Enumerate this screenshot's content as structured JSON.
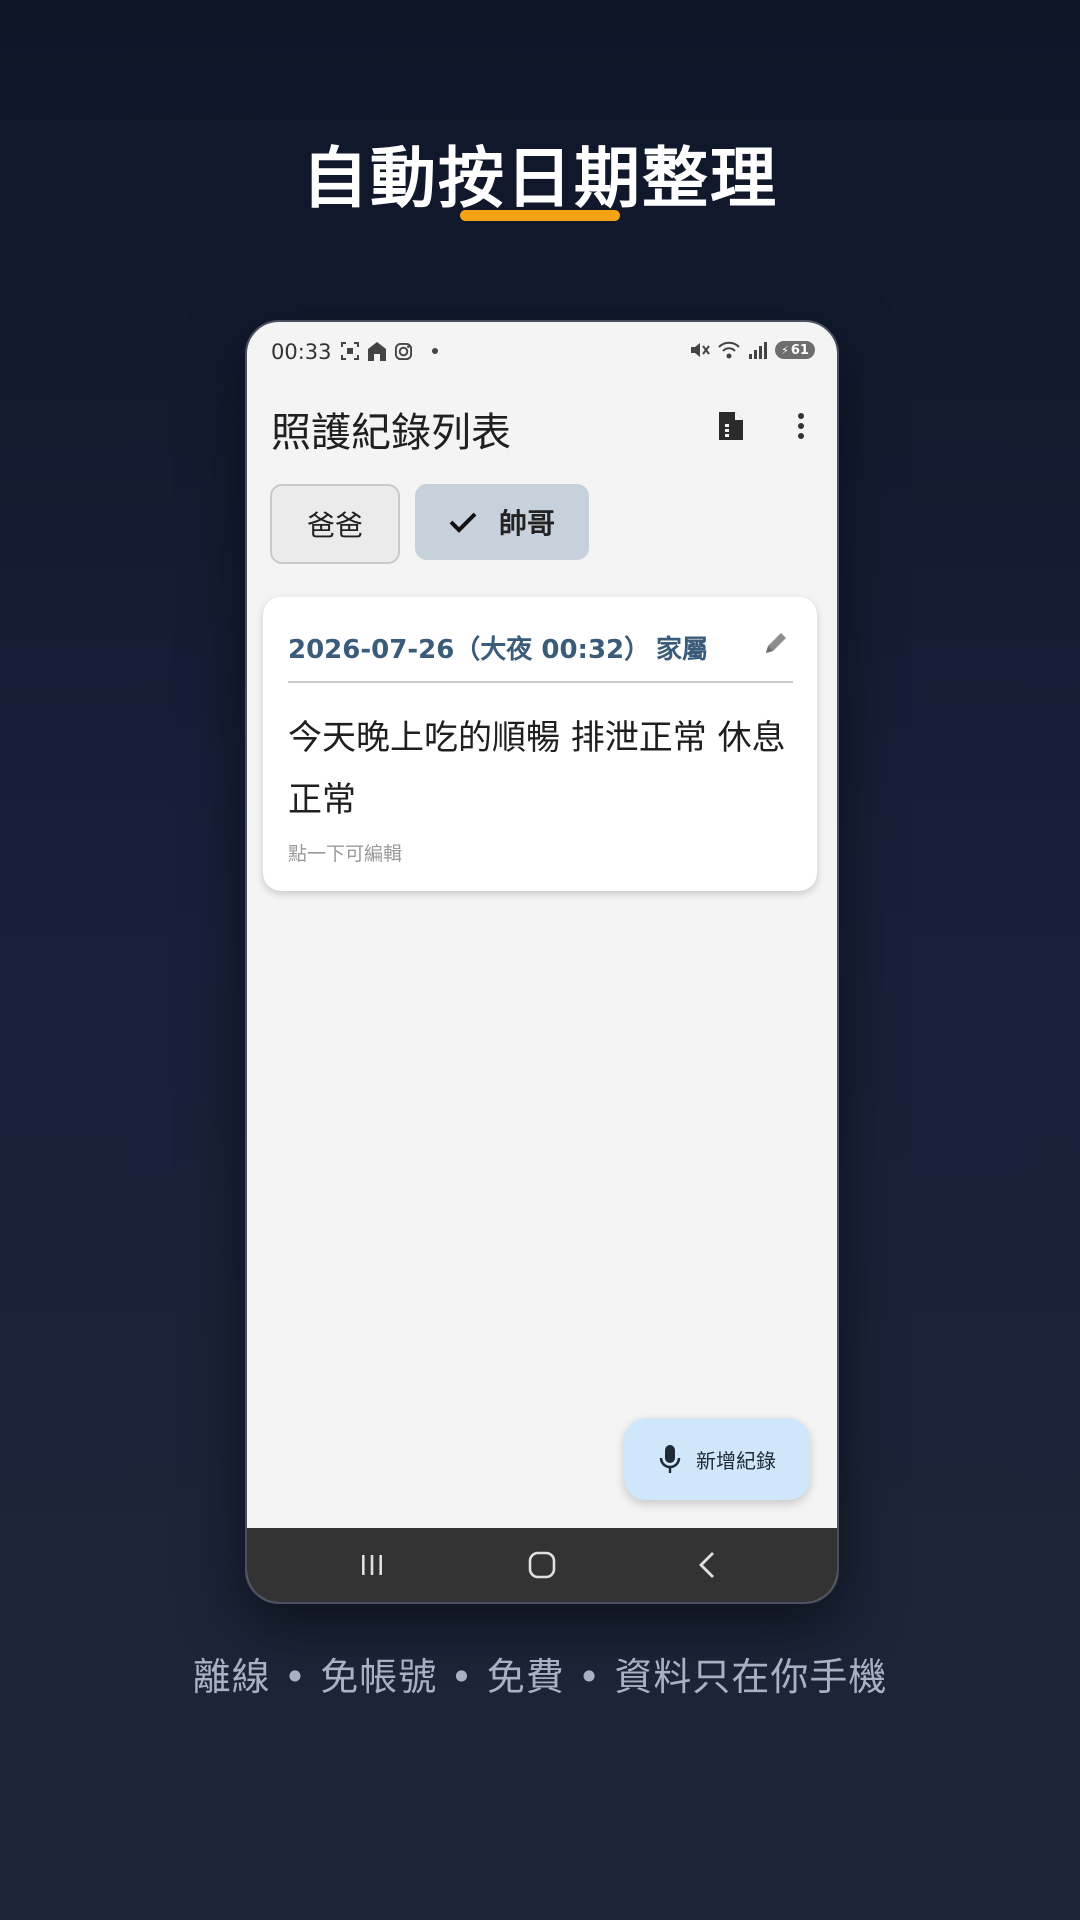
{
  "promo": {
    "title": "自動按日期整理",
    "footer": "離線 • 免帳號 • 免費 • 資料只在你手機",
    "accent_color": "#f5a214"
  },
  "status_bar": {
    "time": "00:33",
    "battery": "61",
    "left_icons": [
      "screenshot-icon",
      "home-icon",
      "instagram-icon",
      "dot-icon"
    ],
    "right_icons": [
      "mute-icon",
      "wifi-icon",
      "signal-icon",
      "battery-icon"
    ]
  },
  "app_bar": {
    "title": "照護紀錄列表",
    "actions": [
      "export-document-icon",
      "more-vert-icon"
    ]
  },
  "filters": {
    "chips": [
      {
        "label": "爸爸",
        "selected": false
      },
      {
        "label": "帥哥",
        "selected": true
      }
    ]
  },
  "records": [
    {
      "date": "2026-07-26（大夜 00:32）",
      "author": "家屬",
      "text": "今天晚上吃的順暢 排泄正常 休息正常",
      "hint": "點一下可編輯"
    }
  ],
  "fab": {
    "label": "新增紀錄",
    "icon": "mic-icon",
    "color": "#cfe6fb"
  },
  "nav": {
    "buttons": [
      "recents-icon",
      "home-circle-icon",
      "back-icon"
    ]
  }
}
